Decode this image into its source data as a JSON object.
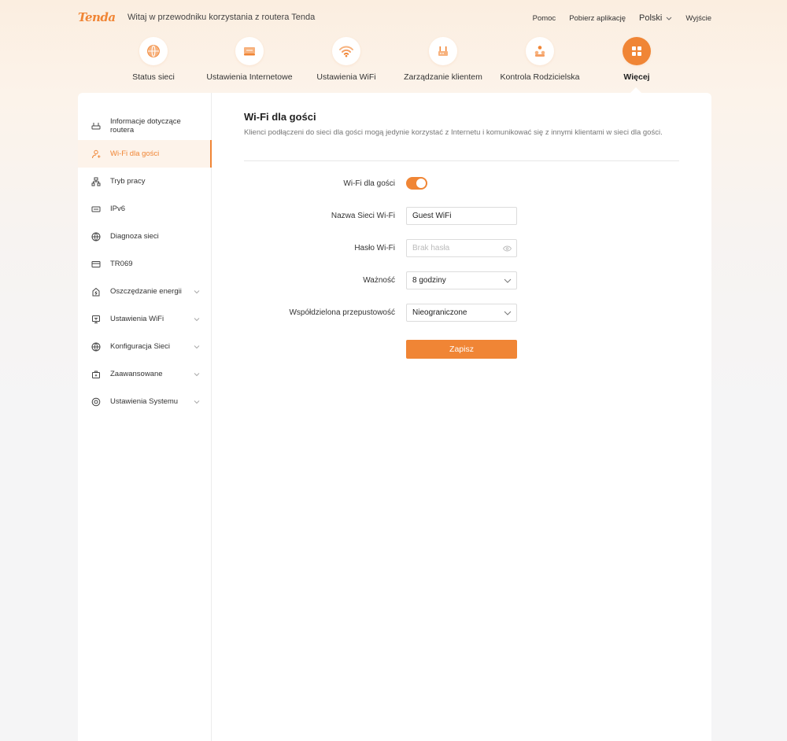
{
  "header": {
    "logo": "Tenda",
    "welcome": "Witaj w przewodniku korzystania z routera Tenda",
    "links": {
      "help": "Pomoc",
      "download_app": "Pobierz aplikację",
      "language": "Polski",
      "logout": "Wyjście"
    }
  },
  "nav": {
    "items": [
      {
        "label": "Status sieci",
        "icon": "globe-icon"
      },
      {
        "label": "Ustawienia Internetowe",
        "icon": "internet-settings-icon"
      },
      {
        "label": "Ustawienia WiFi",
        "icon": "wifi-icon"
      },
      {
        "label": "Zarządzanie klientem",
        "icon": "router-icon"
      },
      {
        "label": "Kontrola Rodzicielska",
        "icon": "parental-control-icon"
      },
      {
        "label": "Więcej",
        "icon": "grid-icon",
        "active": true
      }
    ]
  },
  "sidebar": {
    "items": [
      {
        "label": "Informacje dotyczące routera",
        "icon": "router-info-icon"
      },
      {
        "label": "Wi-Fi dla gości",
        "icon": "guest-icon",
        "active": true
      },
      {
        "label": "Tryb pracy",
        "icon": "work-mode-icon"
      },
      {
        "label": "IPv6",
        "icon": "ipv6-icon"
      },
      {
        "label": "Diagnoza sieci",
        "icon": "globe-icon"
      },
      {
        "label": "TR069",
        "icon": "tr069-icon"
      },
      {
        "label": "Oszczędzanie energii",
        "icon": "energy-icon",
        "expandable": true
      },
      {
        "label": "Ustawienia WiFi",
        "icon": "wifi-settings-icon",
        "expandable": true
      },
      {
        "label": "Konfiguracja Sieci",
        "icon": "globe-icon",
        "expandable": true
      },
      {
        "label": "Zaawansowane",
        "icon": "toolbox-icon",
        "expandable": true
      },
      {
        "label": "Ustawienia Systemu",
        "icon": "system-settings-icon",
        "expandable": true
      }
    ]
  },
  "main": {
    "title": "Wi-Fi dla gości",
    "description": "Klienci podłączeni do sieci dla gości mogą jedynie korzystać z Internetu i komunikować się z innymi klientami w sieci dla gości.",
    "form": {
      "guest_wifi_label": "Wi-Fi dla gości",
      "guest_wifi_enabled": true,
      "ssid_label": "Nazwa Sieci Wi-Fi",
      "ssid_value": "Guest WiFi",
      "password_label": "Hasło Wi-Fi",
      "password_placeholder": "Brak hasła",
      "validity_label": "Ważność",
      "validity_value": "8 godziny",
      "bandwidth_label": "Współdzielona przepustowość",
      "bandwidth_value": "Nieograniczone",
      "save_label": "Zapisz"
    }
  },
  "colors": {
    "accent": "#f08535",
    "active_bg": "#fdf3ea"
  }
}
